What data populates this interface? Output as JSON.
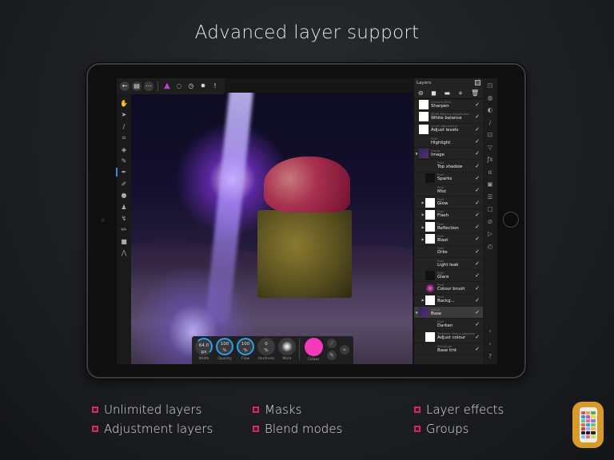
{
  "headline": "Advanced layer support",
  "top_toolbar": {
    "items": [
      {
        "icon": "back-arrow-icon",
        "glyph": "←"
      },
      {
        "icon": "document-icon",
        "glyph": "▤"
      },
      {
        "icon": "more-icon",
        "glyph": "⋯"
      },
      {
        "icon": "pixel-persona-icon",
        "glyph": "▲"
      },
      {
        "icon": "selection-lasso-icon",
        "glyph": "◌"
      },
      {
        "icon": "history-icon",
        "glyph": "◷"
      },
      {
        "icon": "settings-icon",
        "glyph": "✹"
      },
      {
        "icon": "help-icon",
        "glyph": "!"
      }
    ]
  },
  "left_tools": [
    {
      "icon": "hand-tool-icon",
      "glyph": "✋"
    },
    {
      "icon": "move-tool-icon",
      "glyph": "➤"
    },
    {
      "icon": "color-picker-icon",
      "glyph": "∕"
    },
    {
      "icon": "crop-tool-icon",
      "glyph": "⌗"
    },
    {
      "icon": "flood-fill-icon",
      "glyph": "◈"
    },
    {
      "icon": "selection-brush-icon",
      "glyph": "✎"
    },
    {
      "icon": "paint-brush-icon",
      "glyph": "✒",
      "active": true
    },
    {
      "icon": "eraser-icon",
      "glyph": "✐"
    },
    {
      "icon": "dodge-burn-icon",
      "glyph": "●"
    },
    {
      "icon": "clone-stamp-icon",
      "glyph": "♟"
    },
    {
      "icon": "smudge-icon",
      "glyph": "↯"
    },
    {
      "icon": "healing-brush-icon",
      "glyph": "✏"
    },
    {
      "icon": "rectangle-shape-icon",
      "glyph": "■"
    },
    {
      "icon": "pen-tool-icon",
      "glyph": "⋀"
    }
  ],
  "brush_bar": {
    "dials": [
      {
        "label": "Width",
        "value": "64.0",
        "unit": "px"
      },
      {
        "label": "Opacity",
        "value": "100",
        "unit": "%"
      },
      {
        "label": "Flow",
        "value": "100",
        "unit": "%"
      },
      {
        "label": "Hardness",
        "value": "0",
        "unit": "%"
      },
      {
        "label": "More",
        "value": "",
        "unit": ""
      }
    ],
    "colour_label": "Colour",
    "colour": "#f23bb8"
  },
  "layers_panel": {
    "title": "Layers",
    "actions": [
      {
        "icon": "mask-icon",
        "glyph": "⊖"
      },
      {
        "icon": "adjustment-icon",
        "glyph": "◼"
      },
      {
        "icon": "folder-icon",
        "glyph": "▬"
      },
      {
        "icon": "add-layer-icon",
        "glyph": "+"
      },
      {
        "icon": "delete-layer-icon",
        "glyph": "🗑"
      }
    ],
    "layers": [
      {
        "type": "Unsharp Mask",
        "name": "Sharpen",
        "thumb": "white",
        "indent": false
      },
      {
        "type": "White Balance Adjustment",
        "name": "White balance",
        "thumb": "white",
        "indent": false
      },
      {
        "type": "Levels Adjustment",
        "name": "Adjust levels",
        "thumb": "white",
        "indent": false
      },
      {
        "type": "Pixel",
        "name": "Highlight",
        "thumb": "none",
        "indent": false
      },
      {
        "type": "Group",
        "name": "Image",
        "thumb": "img",
        "indent": false,
        "expand": "▼",
        "selected": false
      },
      {
        "type": "Pixel",
        "name": "Top shadow",
        "thumb": "none",
        "indent": true
      },
      {
        "type": "Pixel",
        "name": "Sparks",
        "thumb": "dark",
        "indent": true
      },
      {
        "type": "Pixel",
        "name": "Mist",
        "thumb": "none",
        "indent": true
      },
      {
        "type": "Pixel",
        "name": "Glow",
        "thumb": "white",
        "indent": true,
        "expand": "▶"
      },
      {
        "type": "Pixel",
        "name": "Flash",
        "thumb": "white",
        "indent": true,
        "expand": "▶"
      },
      {
        "type": "Pixel",
        "name": "Reflection",
        "thumb": "white",
        "indent": true,
        "expand": "▶"
      },
      {
        "type": "Pixel",
        "name": "Blast",
        "thumb": "white",
        "indent": true,
        "expand": "▶"
      },
      {
        "type": "Pixel",
        "name": "Orbs",
        "thumb": "none",
        "indent": true
      },
      {
        "type": "Pixel",
        "name": "Light leak",
        "thumb": "none",
        "indent": true
      },
      {
        "type": "Pixel",
        "name": "Glare",
        "thumb": "dark",
        "indent": true
      },
      {
        "type": "Pixel",
        "name": "Colour brush",
        "thumb": "pink",
        "indent": true
      },
      {
        "type": "Pixel",
        "name": "Backg...",
        "thumb": "white",
        "indent": true,
        "expand": "▶"
      },
      {
        "type": "Group",
        "name": "Base",
        "thumb": "img",
        "indent": false,
        "expand": "▼",
        "selected": true
      },
      {
        "type": "Pixel",
        "name": "Darken",
        "thumb": "none",
        "indent": true
      },
      {
        "type": "Selective Colour Adjustment",
        "name": "Adjust colour",
        "thumb": "white",
        "indent": true
      },
      {
        "type": "Rectangle",
        "name": "Base tint",
        "thumb": "none",
        "indent": true
      }
    ],
    "check_glyph": "✓"
  },
  "studio_tabs": [
    {
      "icon": "layers-tab-icon",
      "glyph": "◳"
    },
    {
      "icon": "channels-tab-icon",
      "glyph": "◍"
    },
    {
      "icon": "adjustments-tab-icon",
      "glyph": "◐"
    },
    {
      "icon": "brushes-tab-icon",
      "glyph": "∕"
    },
    {
      "icon": "navigator-tab-icon",
      "glyph": "⊡"
    },
    {
      "icon": "filters-tab-icon",
      "glyph": "▽"
    },
    {
      "icon": "fx-tab-icon",
      "glyph": "ƒx"
    },
    {
      "icon": "text-styles-tab-icon",
      "glyph": "α"
    },
    {
      "icon": "photo-tab-icon",
      "glyph": "▣"
    },
    {
      "icon": "list-tab-icon",
      "glyph": "☰"
    },
    {
      "icon": "transform-tab-icon",
      "glyph": "□"
    },
    {
      "icon": "blocked-tab-icon",
      "glyph": "⊘"
    },
    {
      "icon": "macro-play-tab-icon",
      "glyph": "▷"
    },
    {
      "icon": "history-tab-icon",
      "glyph": "◴"
    }
  ],
  "studio_bottom": [
    {
      "icon": "chevron-left-icon",
      "glyph": "‹"
    },
    {
      "icon": "chevron-right-icon",
      "glyph": "›"
    },
    {
      "icon": "help-icon",
      "glyph": "?"
    }
  ],
  "features": [
    "Unlimited layers",
    "Adjustment layers",
    "Masks",
    "Blend modes",
    "Layer effects",
    "Groups"
  ],
  "accent_color": "#d02a5e"
}
